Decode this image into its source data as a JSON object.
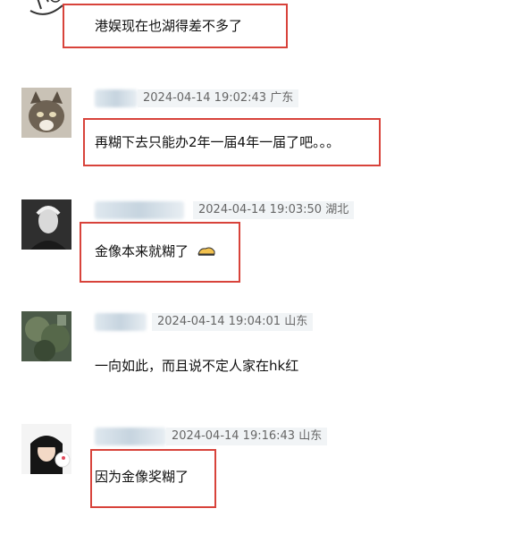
{
  "comments": [
    {
      "text": "港娱现在也湖得差不多了"
    },
    {
      "timestamp": "2024-04-14 19:02:43",
      "location": "广东",
      "text": "再糊下去只能办2年一届4年一届了吧。。。"
    },
    {
      "timestamp": "2024-04-14 19:03:50",
      "location": "湖北",
      "text": "金像本来就糊了"
    },
    {
      "timestamp": "2024-04-14 19:04:01",
      "location": "山东",
      "text": "一向如此，而且说不定人家在hk红"
    },
    {
      "timestamp": "2024-04-14 19:16:43",
      "location": "山东",
      "text": "因为金像奖糊了"
    }
  ],
  "colors": {
    "highlight_box": "#d8433b",
    "meta_bg": "#f1f4f6",
    "meta_text": "#666666"
  }
}
